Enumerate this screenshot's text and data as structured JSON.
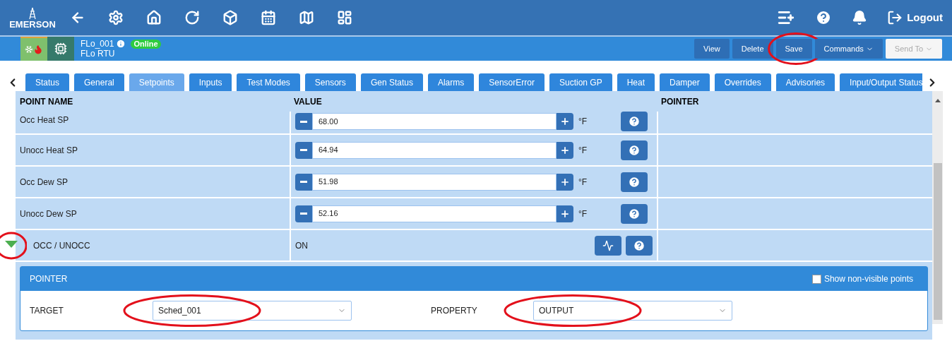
{
  "top_bar": {
    "logo": "EMERSON",
    "logout": "Logout"
  },
  "device": {
    "name": "FLo_001",
    "type": "FLo RTU",
    "status": "Online"
  },
  "actions": [
    {
      "label": "View",
      "disabled": false,
      "dropdown": false,
      "circled": false
    },
    {
      "label": "Delete",
      "disabled": false,
      "dropdown": false,
      "circled": false
    },
    {
      "label": "Save",
      "disabled": false,
      "dropdown": false,
      "circled": true
    },
    {
      "label": "Commands",
      "disabled": false,
      "dropdown": true,
      "circled": false
    },
    {
      "label": "Send To",
      "disabled": true,
      "dropdown": true,
      "circled": false
    }
  ],
  "tabs": [
    {
      "label": "Status",
      "selected": false
    },
    {
      "label": "General",
      "selected": false
    },
    {
      "label": "Setpoints",
      "selected": true
    },
    {
      "label": "Inputs",
      "selected": false
    },
    {
      "label": "Test Modes",
      "selected": false
    },
    {
      "label": "Sensors",
      "selected": false
    },
    {
      "label": "Gen Status",
      "selected": false
    },
    {
      "label": "Alarms",
      "selected": false
    },
    {
      "label": "SensorError",
      "selected": false
    },
    {
      "label": "Suction GP",
      "selected": false
    },
    {
      "label": "Heat",
      "selected": false
    },
    {
      "label": "Damper",
      "selected": false
    },
    {
      "label": "Overrides",
      "selected": false
    },
    {
      "label": "Advisories",
      "selected": false
    },
    {
      "label": "Input/Output Status",
      "selected": false
    }
  ],
  "table": {
    "columns": [
      "POINT NAME",
      "VALUE",
      "POINTER"
    ],
    "rows": [
      {
        "kind": "setpoint",
        "name": "Occ Heat SP",
        "value": "68.00",
        "unit": "°F"
      },
      {
        "kind": "setpoint",
        "name": "Unocc Heat SP",
        "value": "64.94",
        "unit": "°F"
      },
      {
        "kind": "setpoint",
        "name": "Occ Dew SP",
        "value": "51.98",
        "unit": "°F"
      },
      {
        "kind": "setpoint",
        "name": "Unocc Dew SP",
        "value": "52.16",
        "unit": "°F"
      },
      {
        "kind": "status",
        "name": "OCC / UNOCC",
        "value": "ON",
        "expanded": true,
        "circled": true
      }
    ]
  },
  "pointer_panel": {
    "title": "POINTER",
    "show_nonvisible": {
      "label": "Show non-visible points",
      "checked": false
    },
    "fields": [
      {
        "label": "TARGET",
        "value": "Sched_001",
        "circled": true
      },
      {
        "label": "PROPERTY",
        "value": "OUTPUT",
        "circled": true
      }
    ]
  }
}
